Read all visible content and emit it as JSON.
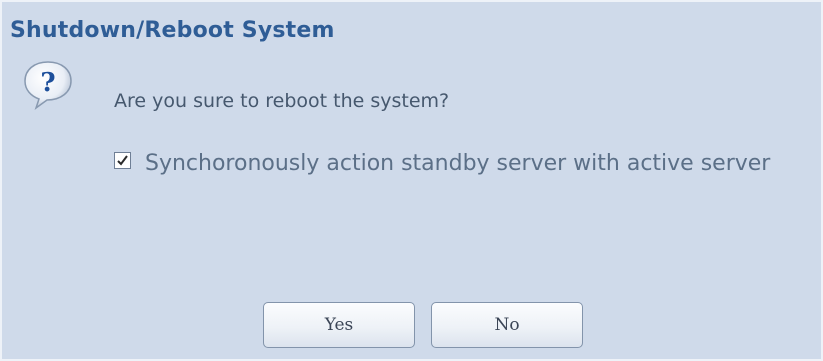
{
  "dialog": {
    "title": "Shutdown/Reboot System",
    "icon": "question-icon",
    "message": "Are you sure to reboot the system?",
    "sync_option": {
      "label": "Synchoronously action standby server with active server",
      "checked": true
    },
    "buttons": {
      "yes": "Yes",
      "no": "No"
    }
  },
  "colors": {
    "background": "#cfdaea",
    "title": "#2f5d96",
    "icon_blue": "#1d4f9b"
  }
}
